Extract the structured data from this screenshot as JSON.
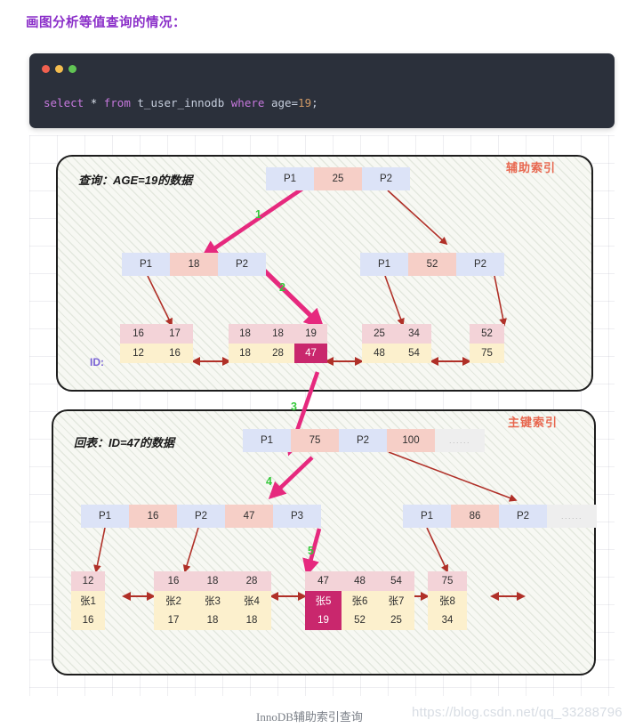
{
  "heading": "画图分析等值查询的情况：",
  "code": {
    "tokens": [
      {
        "t": "select",
        "c": "kw"
      },
      {
        "t": " ",
        "c": "op"
      },
      {
        "t": "*",
        "c": "op"
      },
      {
        "t": " ",
        "c": "op"
      },
      {
        "t": "from",
        "c": "kw"
      },
      {
        "t": " ",
        "c": "op"
      },
      {
        "t": "t_user_innodb",
        "c": "id"
      },
      {
        "t": " ",
        "c": "op"
      },
      {
        "t": "where",
        "c": "kw"
      },
      {
        "t": " ",
        "c": "op"
      },
      {
        "t": "age=",
        "c": "id"
      },
      {
        "t": "19",
        "c": "num"
      },
      {
        "t": ";",
        "c": "pn"
      }
    ],
    "plain": "select * from t_user_innodb where age=19;",
    "window_dots": [
      "close-red",
      "minimize-yellow",
      "maximize-green"
    ]
  },
  "panels": {
    "secondary": {
      "tag": "辅助索引",
      "note": "查询：AGE=19的数据"
    },
    "primary": {
      "tag": "主键索引",
      "note": "回表：ID=47的数据"
    }
  },
  "labels": {
    "id_prefix": "ID:",
    "steps": [
      "1",
      "2",
      "3",
      "4",
      "5"
    ]
  },
  "secondary_index": {
    "root": [
      "P1",
      "25",
      "P2"
    ],
    "internal_left": [
      "P1",
      "18",
      "P2"
    ],
    "internal_right": [
      "P1",
      "52",
      "P2"
    ],
    "leaves": [
      {
        "keys": [
          "16",
          "17"
        ],
        "ids": [
          "12",
          "16"
        ],
        "highlight": -1
      },
      {
        "keys": [
          "18",
          "18",
          "19"
        ],
        "ids": [
          "18",
          "28",
          "47"
        ],
        "highlight": 2
      },
      {
        "keys": [
          "25",
          "34"
        ],
        "ids": [
          "48",
          "54"
        ],
        "highlight": -1
      },
      {
        "keys": [
          "52"
        ],
        "ids": [
          "75"
        ],
        "highlight": -1
      }
    ]
  },
  "primary_index": {
    "root": [
      "P1",
      "75",
      "P2",
      "100",
      "......"
    ],
    "internal_left": [
      "P1",
      "16",
      "P2",
      "47",
      "P3"
    ],
    "internal_right": [
      "P1",
      "86",
      "P2",
      "......"
    ],
    "leaves": [
      {
        "ids": [
          "12"
        ],
        "names": [
          "张1"
        ],
        "ages": [
          "16"
        ],
        "highlight": -1
      },
      {
        "ids": [
          "16",
          "18",
          "28"
        ],
        "names": [
          "张2",
          "张3",
          "张4"
        ],
        "ages": [
          "17",
          "18",
          "18"
        ],
        "highlight": -1
      },
      {
        "ids": [
          "47",
          "48",
          "54"
        ],
        "names": [
          "张5",
          "张6",
          "张7"
        ],
        "ages": [
          "19",
          "52",
          "25"
        ],
        "highlight": 0
      },
      {
        "ids": [
          "75"
        ],
        "names": [
          "张8"
        ],
        "ages": [
          "34"
        ],
        "highlight": -1
      }
    ]
  },
  "caption": "InnoDB辅助索引查询",
  "watermark": "https://blog.csdn.net/qq_33288796",
  "colors": {
    "heading": "#8b2fc9",
    "tag": "#e8674f",
    "pointer_cell": "#dce3f7",
    "key_cell": "#f6cfc7",
    "id_cell": "#fcf0cd",
    "highlight": "#c9276d",
    "step": "#36c93b",
    "thin_arrow": "#b03028",
    "thick_arrow": "#e6297e"
  }
}
